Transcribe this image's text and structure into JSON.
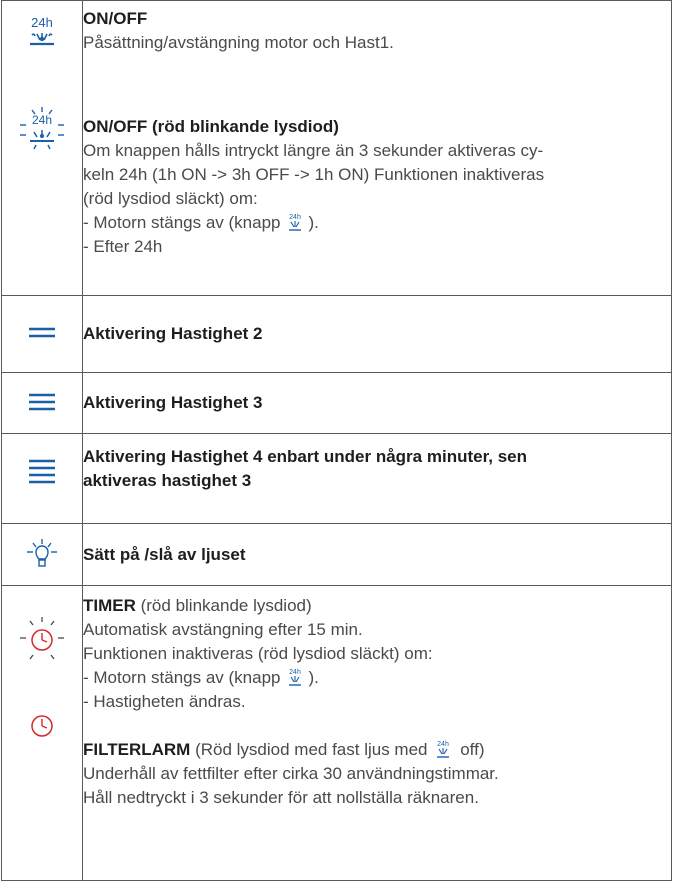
{
  "rows": {
    "onoff": {
      "icon": "fan-24h-icon",
      "title": "ON/OFF",
      "text": "Påsättning/avstängning motor och Hast1.",
      "blink_icon": "fan-24h-blinking-icon",
      "blink_title": "ON/OFF (röd blinkande lysdiod)",
      "blink_text_1": "Om knappen hålls intryckt längre än 3 sekunder aktiveras cy-",
      "blink_text_2": "keln 24h (1h ON -> 3h OFF -> 1h ON) Funktionen inaktiveras",
      "blink_text_3": "(röd lysdiod släckt) om:",
      "blink_text_4a": "- Motorn stängs av (knapp",
      "blink_text_4b": ").",
      "blink_text_5": "- Efter 24h"
    },
    "speed2": {
      "icon": "speed-2-lines-icon",
      "label": "Aktivering Hastighet 2"
    },
    "speed3": {
      "icon": "speed-3-lines-icon",
      "label": "Aktivering Hastighet 3"
    },
    "speed4": {
      "icon": "speed-4-lines-icon",
      "label_1": "Aktivering Hastighet 4 enbart under några minuter, sen",
      "label_2": "aktiveras hastighet 3"
    },
    "light": {
      "icon": "lamp-icon",
      "label": "Sätt på /slå av ljuset"
    },
    "timer": {
      "icon": "timer-blinking-icon",
      "icon_2": "timer-icon",
      "title": "TIMER",
      "title_suffix": " (röd blinkande lysdiod)",
      "text_1": "Automatisk avstängning efter 15 min.",
      "text_2": "Funktionen inaktiveras (röd lysdiod släckt) om:",
      "text_3a": "- Motorn stängs av (knapp",
      "text_3b": ").",
      "text_4": "- Hastigheten ändras.",
      "filter_title": "FILTERLARM",
      "filter_suffix_a": " (Röd lysdiod med fast ljus med",
      "filter_suffix_b": " off)",
      "filter_text_1": "Underhåll av fettfilter efter cirka 30 användningstimmar.",
      "filter_text_2": "Håll nedtryckt i 3 sekunder för att nollställa räknaren."
    }
  },
  "colors": {
    "accent_blue": "#1a5fa8",
    "icon_red": "#d62828",
    "border": "#5a5a5a"
  }
}
